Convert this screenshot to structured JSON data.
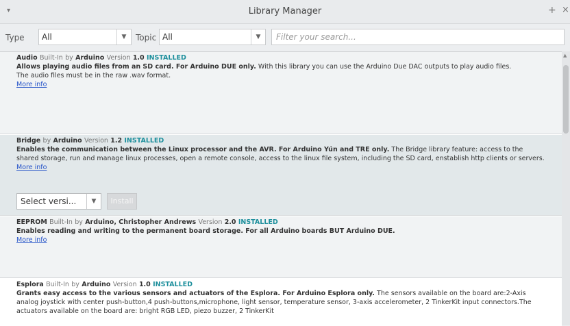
{
  "window": {
    "title": "Library Manager",
    "plus": "+",
    "close": "×",
    "menu_arrow": "▾"
  },
  "filters": {
    "type_label": "Type",
    "type_value": "All",
    "topic_label": "Topic",
    "topic_value": "All",
    "search_placeholder": "Filter your search..."
  },
  "libraries": [
    {
      "name": "Audio",
      "builtin": "Built-In",
      "by_label": "by",
      "author": "Arduino",
      "version_label": "Version",
      "version": "1.0",
      "status": "INSTALLED",
      "summary": "Allows playing audio files from an SD card. For Arduino DUE only.",
      "details": "With this library you can use the Arduino Due DAC outputs to play audio files.",
      "extra": "The audio files must be in the raw .wav format.",
      "more": "More info"
    },
    {
      "name": "Bridge",
      "by_label": "by",
      "author": "Arduino",
      "version_label": "Version",
      "version": "1.2",
      "status": "INSTALLED",
      "summary": "Enables the communication between the Linux processor and the AVR. For Arduino Yún and TRE only.",
      "details": "The Bridge library feature: access to the shared storage, run and manage linux processes, open a remote console, access to the linux file system, including the SD card, enstablish http clients or servers.",
      "more": "More info",
      "select_version": "Select versi...",
      "install": "Install"
    },
    {
      "name": "EEPROM",
      "builtin": "Built-In",
      "by_label": "by",
      "author": "Arduino, Christopher Andrews",
      "version_label": "Version",
      "version": "2.0",
      "status": "INSTALLED",
      "summary": "Enables reading and writing to the permanent board storage. For all Arduino boards BUT Arduino DUE.",
      "more": "More info"
    },
    {
      "name": "Esplora",
      "builtin": "Built-In",
      "by_label": "by",
      "author": "Arduino",
      "version_label": "Version",
      "version": "1.0",
      "status": "INSTALLED",
      "summary": "Grants easy access to the various sensors and actuators of the Esplora. For Arduino Esplora only.",
      "details": "The sensors available on the board are:2-Axis analog joystick with center push-button,4 push-buttons,microphone, light sensor, temperature sensor, 3-axis accelerometer, 2 TinkerKit input connectors.The actuators available on the board are: bright RGB LED, piezo buzzer, 2 TinkerKit"
    }
  ]
}
